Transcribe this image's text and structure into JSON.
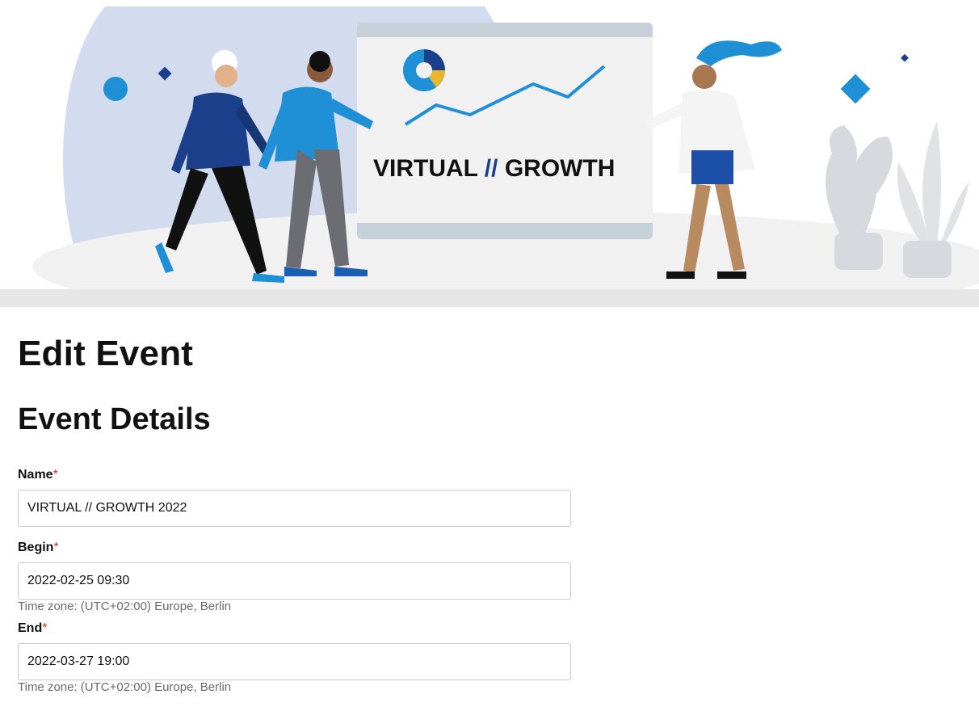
{
  "banner": {
    "screen_text_left": "VIRTUAL",
    "screen_text_sep": "//",
    "screen_text_right": "GROWTH",
    "colors": {
      "blue": "#1f8fd6",
      "navy": "#1b3f8b",
      "bg_shape": "#d3dcee"
    }
  },
  "page": {
    "title": "Edit Event"
  },
  "section": {
    "title": "Event Details"
  },
  "fields": {
    "name": {
      "label": "Name",
      "required_mark": "*",
      "value": "VIRTUAL // GROWTH 2022"
    },
    "begin": {
      "label": "Begin",
      "required_mark": "*",
      "value": "2022-02-25 09:30",
      "hint": "Time zone: (UTC+02:00) Europe, Berlin"
    },
    "end": {
      "label": "End",
      "required_mark": "*",
      "value": "2022-03-27 19:00",
      "hint": "Time zone: (UTC+02:00) Europe, Berlin"
    }
  }
}
